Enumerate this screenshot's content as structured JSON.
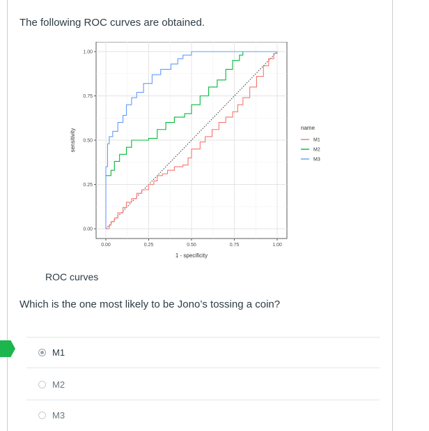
{
  "question": {
    "intro": "The following ROC curves are obtained.",
    "caption": "ROC curves",
    "prompt": "Which is the one most likely to be Jono’s tossing a coin?"
  },
  "answers": [
    {
      "label": "M1",
      "selected": true
    },
    {
      "label": "M2",
      "selected": false
    },
    {
      "label": "M3",
      "selected": false
    }
  ],
  "colors": {
    "M1": "#f8766d",
    "M2": "#00ba38",
    "M3": "#619cff",
    "marker": "#1cb54e"
  },
  "chart_data": {
    "type": "line",
    "title": "",
    "xlabel": "1 - specificity",
    "ylabel": "sensitivity",
    "xlim": [
      0,
      1
    ],
    "ylim": [
      0,
      1
    ],
    "xticks": [
      "0.00",
      "0.25",
      "0.50",
      "0.75",
      "1.00"
    ],
    "yticks": [
      "0.00",
      "0.25",
      "0.50",
      "0.75",
      "1.00"
    ],
    "grid": true,
    "diagonal_reference": true,
    "legend": {
      "title": "name",
      "position": "right"
    },
    "series": [
      {
        "name": "M1",
        "color": "#f8766d",
        "points": [
          [
            0,
            0
          ],
          [
            0.02,
            0.02
          ],
          [
            0.03,
            0.04
          ],
          [
            0.05,
            0.06
          ],
          [
            0.07,
            0.09
          ],
          [
            0.1,
            0.12
          ],
          [
            0.12,
            0.15
          ],
          [
            0.15,
            0.17
          ],
          [
            0.18,
            0.2
          ],
          [
            0.21,
            0.22
          ],
          [
            0.25,
            0.25
          ],
          [
            0.28,
            0.27
          ],
          [
            0.3,
            0.3
          ],
          [
            0.33,
            0.31
          ],
          [
            0.36,
            0.33
          ],
          [
            0.4,
            0.35
          ],
          [
            0.45,
            0.36
          ],
          [
            0.48,
            0.4
          ],
          [
            0.5,
            0.45
          ],
          [
            0.55,
            0.49
          ],
          [
            0.58,
            0.52
          ],
          [
            0.62,
            0.56
          ],
          [
            0.66,
            0.6
          ],
          [
            0.7,
            0.63
          ],
          [
            0.74,
            0.66
          ],
          [
            0.77,
            0.7
          ],
          [
            0.8,
            0.74
          ],
          [
            0.84,
            0.8
          ],
          [
            0.88,
            0.86
          ],
          [
            0.92,
            0.92
          ],
          [
            0.95,
            0.96
          ],
          [
            0.98,
            0.99
          ],
          [
            1,
            1
          ]
        ]
      },
      {
        "name": "M2",
        "color": "#00ba38",
        "points": [
          [
            0,
            0.3
          ],
          [
            0.03,
            0.33
          ],
          [
            0.05,
            0.38
          ],
          [
            0.08,
            0.42
          ],
          [
            0.12,
            0.46
          ],
          [
            0.15,
            0.5
          ],
          [
            0.25,
            0.51
          ],
          [
            0.3,
            0.56
          ],
          [
            0.35,
            0.6
          ],
          [
            0.4,
            0.63
          ],
          [
            0.46,
            0.65
          ],
          [
            0.5,
            0.7
          ],
          [
            0.55,
            0.75
          ],
          [
            0.6,
            0.8
          ],
          [
            0.65,
            0.84
          ],
          [
            0.7,
            0.9
          ],
          [
            0.74,
            0.95
          ],
          [
            0.78,
            0.98
          ],
          [
            0.8,
            1
          ],
          [
            1,
            1
          ]
        ]
      },
      {
        "name": "M3",
        "color": "#619cff",
        "points": [
          [
            0,
            0
          ],
          [
            0,
            0.35
          ],
          [
            0.01,
            0.48
          ],
          [
            0.02,
            0.52
          ],
          [
            0.04,
            0.55
          ],
          [
            0.07,
            0.6
          ],
          [
            0.1,
            0.64
          ],
          [
            0.12,
            0.7
          ],
          [
            0.15,
            0.74
          ],
          [
            0.18,
            0.77
          ],
          [
            0.22,
            0.82
          ],
          [
            0.27,
            0.87
          ],
          [
            0.32,
            0.9
          ],
          [
            0.38,
            0.93
          ],
          [
            0.42,
            0.96
          ],
          [
            0.45,
            0.98
          ],
          [
            0.5,
            1
          ],
          [
            1,
            1
          ]
        ]
      }
    ]
  }
}
